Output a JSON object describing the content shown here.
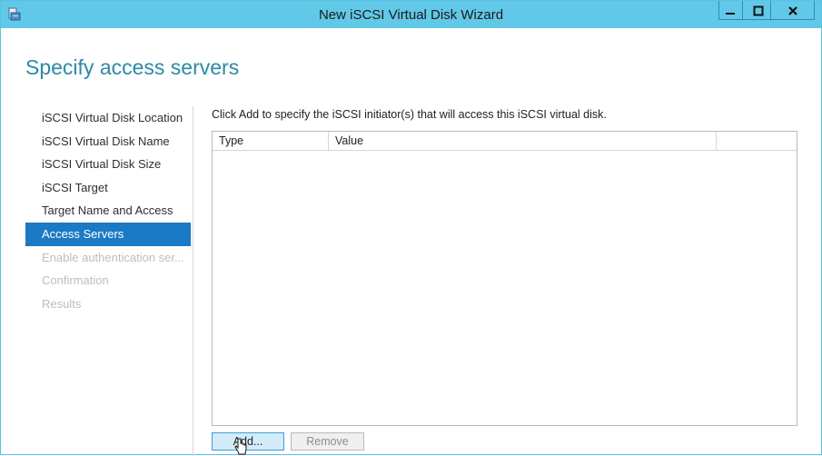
{
  "window": {
    "title": "New iSCSI Virtual Disk Wizard"
  },
  "page": {
    "heading": "Specify access servers",
    "instruction": "Click Add to specify the iSCSI initiator(s) that will access this iSCSI virtual disk."
  },
  "nav": {
    "items": [
      {
        "label": "iSCSI Virtual Disk Location",
        "state": "normal"
      },
      {
        "label": "iSCSI Virtual Disk Name",
        "state": "normal"
      },
      {
        "label": "iSCSI Virtual Disk Size",
        "state": "normal"
      },
      {
        "label": "iSCSI Target",
        "state": "normal"
      },
      {
        "label": "Target Name and Access",
        "state": "normal"
      },
      {
        "label": "Access Servers",
        "state": "active"
      },
      {
        "label": "Enable authentication ser...",
        "state": "disabled"
      },
      {
        "label": "Confirmation",
        "state": "disabled"
      },
      {
        "label": "Results",
        "state": "disabled"
      }
    ]
  },
  "grid": {
    "columns": [
      "Type",
      "Value",
      ""
    ]
  },
  "buttons": {
    "add": "Add...",
    "remove": "Remove"
  },
  "colors": {
    "titlebar": "#62c8e8",
    "accent_heading": "#2c8aa7",
    "selection": "#1c79c5"
  }
}
